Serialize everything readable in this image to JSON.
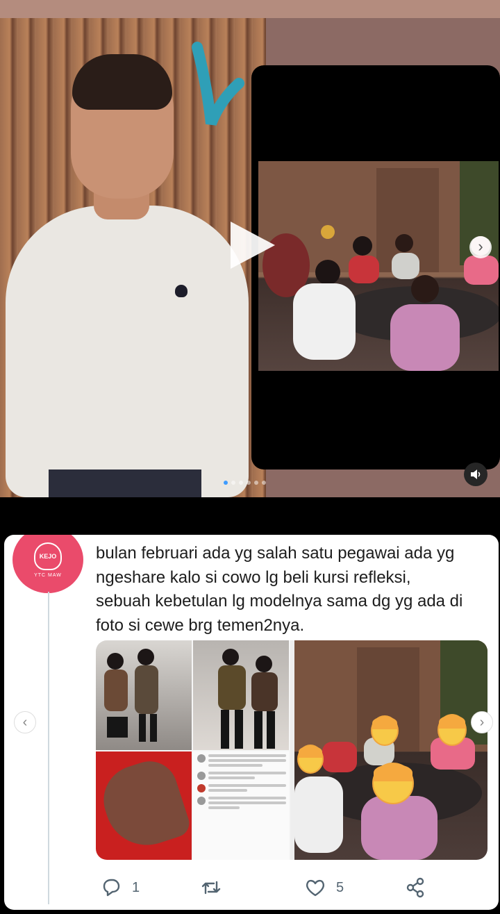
{
  "carousel": {
    "dots_count": 6,
    "active_dot": 0,
    "play_icon": "play-icon",
    "next_icon": "chevron-right-icon",
    "sound_icon": "speaker-icon"
  },
  "tweet": {
    "text_lines": [
      "bulan februari ada yg salah satu pegawai ada yg",
      "ngeshare kalo si cowo lg beli kursi refleksi,",
      "sebuah kebetulan lg modelnya sama dg yg ada di",
      "foto si cewe brg temen2nya."
    ],
    "avatar_label": "KEJO",
    "avatar_sub": "YTC MAW",
    "reply_count": "1",
    "like_count": "5",
    "icons": [
      "reply-icon",
      "retweet-icon",
      "like-icon",
      "share-icon"
    ],
    "accent_color": "#536471"
  },
  "nav": {
    "prev_symbol": "‹",
    "next_symbol": "›"
  }
}
